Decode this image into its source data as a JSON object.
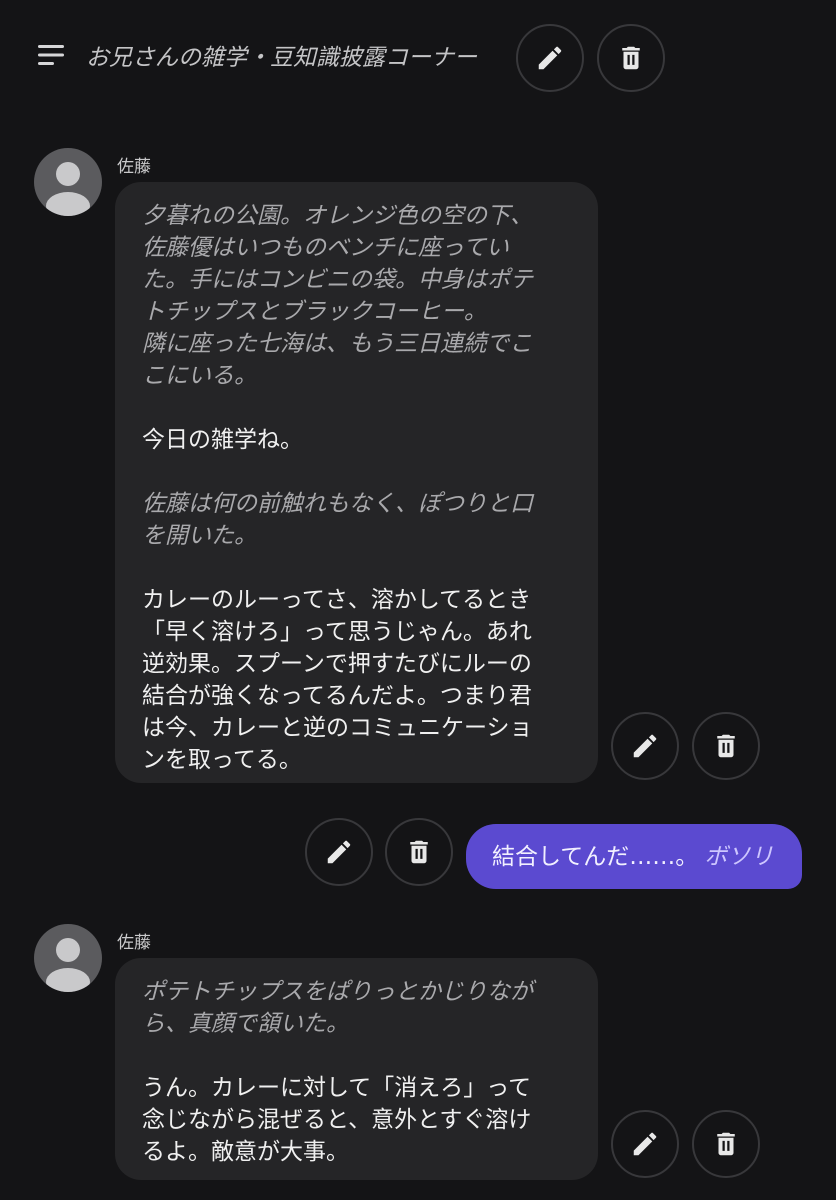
{
  "header": {
    "title": "お兄さんの雑学・豆知識披露コーナー",
    "edit_icon": "pencil-icon",
    "delete_icon": "trash-icon"
  },
  "messages": [
    {
      "sender": "佐藤",
      "lines": [
        {
          "text": "夕暮れの公園。オレンジ色の空の下、",
          "style": "narr"
        },
        {
          "text": "佐藤優はいつものベンチに座ってい",
          "style": "narr"
        },
        {
          "text": "た。手にはコンビニの袋。中身はポテ",
          "style": "narr"
        },
        {
          "text": "トチップスとブラックコーヒー。",
          "style": "narr"
        },
        {
          "text": "隣に座った七海は、もう三日連続でこ",
          "style": "narr"
        },
        {
          "text": "こにいる。",
          "style": "narr"
        },
        {
          "text": "",
          "style": "blank"
        },
        {
          "text": "今日の雑学ね。",
          "style": "talk"
        },
        {
          "text": "",
          "style": "blank"
        },
        {
          "text": "佐藤は何の前触れもなく、ぽつりと口",
          "style": "narr"
        },
        {
          "text": "を開いた。",
          "style": "narr"
        },
        {
          "text": "",
          "style": "blank"
        },
        {
          "text": "カレーのルーってさ、溶かしてるとき",
          "style": "talk"
        },
        {
          "text": "「早く溶けろ」って思うじゃん。あれ",
          "style": "talk"
        },
        {
          "text": "逆効果。スプーンで押すたびにルーの",
          "style": "talk"
        },
        {
          "text": "結合が強くなってるんだよ。つまり君",
          "style": "talk"
        },
        {
          "text": "は今、カレーと逆のコミュニケーショ",
          "style": "talk"
        },
        {
          "text": "ンを取ってる。",
          "style": "talk"
        }
      ]
    },
    {
      "sender": "user",
      "talk": "結合してんだ……。",
      "narr": "ボソリ"
    },
    {
      "sender": "佐藤",
      "lines": [
        {
          "text": "ポテトチップスをぱりっとかじりなが",
          "style": "narr"
        },
        {
          "text": "ら、真顔で頷いた。",
          "style": "narr"
        },
        {
          "text": "",
          "style": "blank"
        },
        {
          "text": "うん。カレーに対して「消えろ」って",
          "style": "talk"
        },
        {
          "text": "念じながら混ぜると、意外とすぐ溶け",
          "style": "talk"
        },
        {
          "text": "るよ。敵意が大事。",
          "style": "talk"
        }
      ]
    }
  ],
  "colors": {
    "background": "#141416",
    "bubble": "#252527",
    "user_bubble": "#5b4ad0",
    "icon": "#e8e8e8"
  }
}
